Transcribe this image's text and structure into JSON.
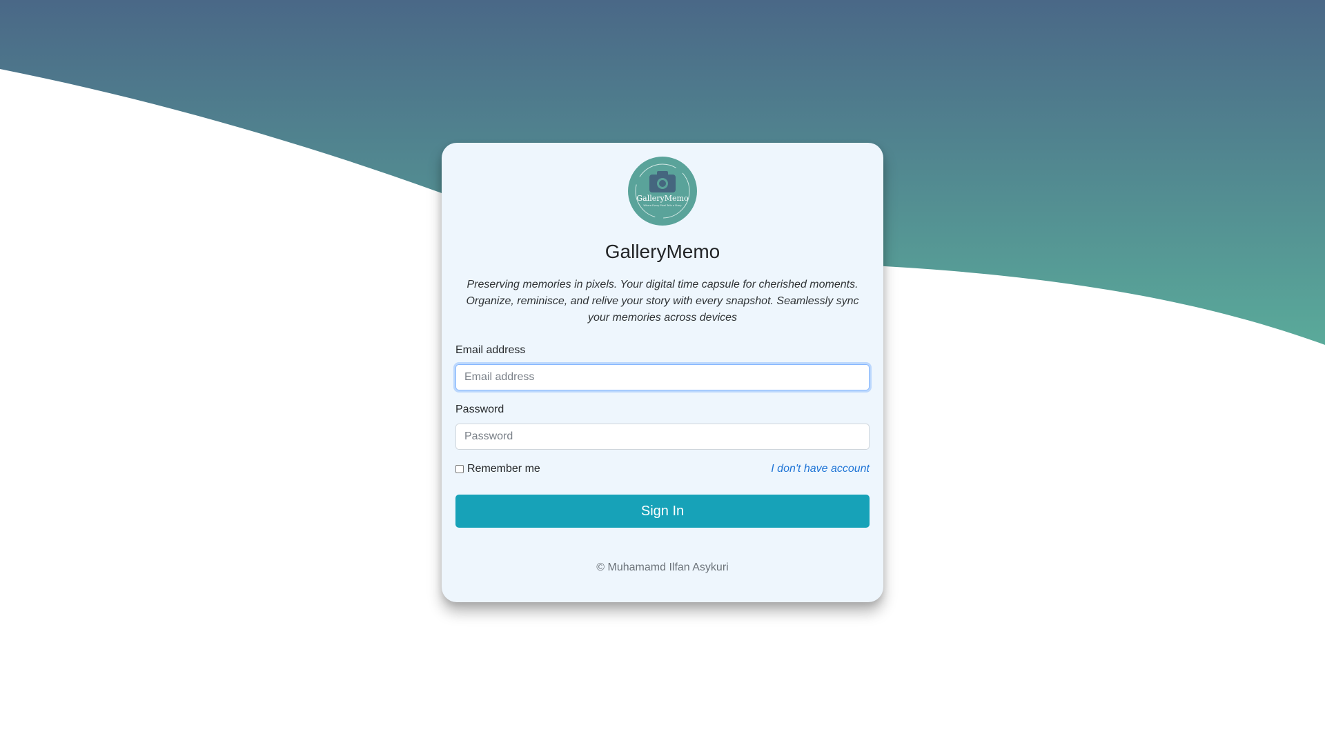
{
  "brand": {
    "name": "GalleryMemo",
    "logo_text": "GalleryMemo",
    "logo_subtext": "Where Every Pixel Tells a Story",
    "tagline": "Preserving memories in pixels. Your digital time capsule for cherished moments. Organize, reminisce, and relive your story with every snapshot. Seamlessly sync your memories across devices"
  },
  "form": {
    "email_label": "Email address",
    "email_placeholder": "Email address",
    "email_value": "",
    "password_label": "Password",
    "password_placeholder": "Password",
    "password_value": "",
    "remember_label": "Remember me",
    "remember_checked": false,
    "no_account_link": "I don't have account",
    "submit_label": "Sign In"
  },
  "footer": {
    "copyright": "© Muhamamd Ilfan Asykuri"
  },
  "colors": {
    "wave_top": "#4a6887",
    "wave_bottom": "#5aaa9a",
    "card_bg": "#eef6fd",
    "logo_bg": "#5aa39a",
    "button_bg": "#17a2b8",
    "link": "#1e74d6"
  }
}
